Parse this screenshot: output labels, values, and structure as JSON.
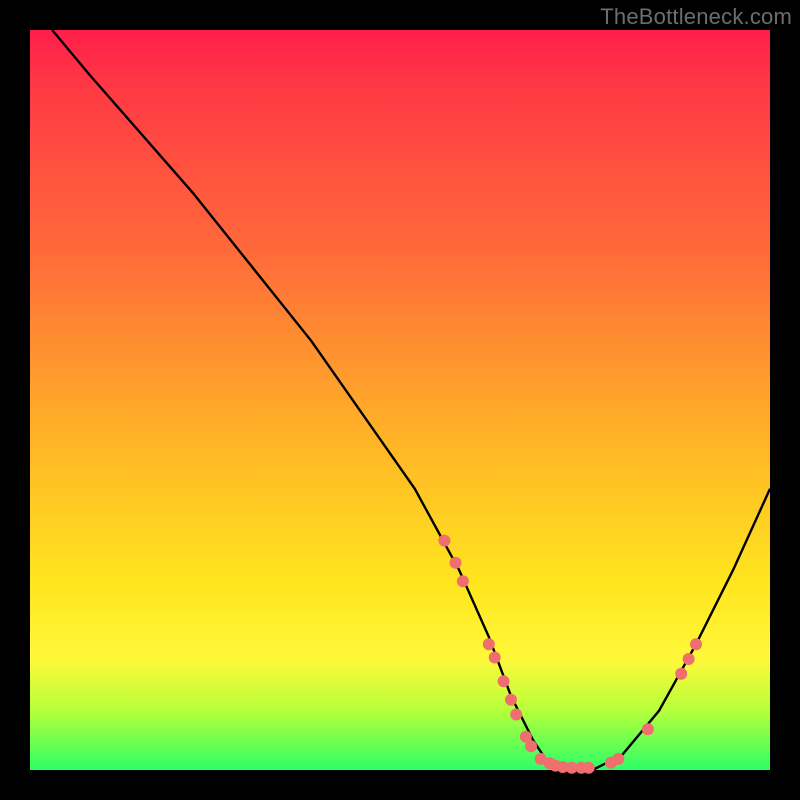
{
  "watermark": "TheBottleneck.com",
  "chart_data": {
    "type": "line",
    "title": "",
    "xlabel": "",
    "ylabel": "",
    "xlim": [
      0,
      100
    ],
    "ylim": [
      0,
      100
    ],
    "background_gradient": {
      "top": "#ff1e4a",
      "upper_mid": "#ff6a3a",
      "mid": "#ffe61e",
      "bottom": "#2bff66"
    },
    "series": [
      {
        "name": "bottleneck-curve",
        "color": "#000000",
        "x": [
          3,
          8,
          15,
          22,
          30,
          38,
          45,
          52,
          58,
          62,
          65,
          68,
          70,
          73,
          76,
          80,
          85,
          90,
          95,
          100
        ],
        "y": [
          100,
          94,
          86,
          78,
          68,
          58,
          48,
          38,
          27,
          18,
          10,
          4,
          1,
          0,
          0,
          2,
          8,
          17,
          27,
          38
        ]
      }
    ],
    "scatter": [
      {
        "name": "marker-dots",
        "color": "#ef6f6f",
        "radius": 6,
        "points": [
          {
            "x": 56,
            "y": 31
          },
          {
            "x": 57.5,
            "y": 28
          },
          {
            "x": 58.5,
            "y": 25.5
          },
          {
            "x": 62,
            "y": 17
          },
          {
            "x": 62.8,
            "y": 15.2
          },
          {
            "x": 64,
            "y": 12
          },
          {
            "x": 65,
            "y": 9.5
          },
          {
            "x": 65.7,
            "y": 7.5
          },
          {
            "x": 67,
            "y": 4.5
          },
          {
            "x": 67.7,
            "y": 3.2
          },
          {
            "x": 69,
            "y": 1.5
          },
          {
            "x": 70.2,
            "y": 0.9
          },
          {
            "x": 71,
            "y": 0.6
          },
          {
            "x": 72,
            "y": 0.4
          },
          {
            "x": 73.2,
            "y": 0.3
          },
          {
            "x": 74.5,
            "y": 0.3
          },
          {
            "x": 75.5,
            "y": 0.3
          },
          {
            "x": 78.5,
            "y": 1.0
          },
          {
            "x": 79.5,
            "y": 1.5
          },
          {
            "x": 83.5,
            "y": 5.5
          },
          {
            "x": 88,
            "y": 13
          },
          {
            "x": 89,
            "y": 15
          },
          {
            "x": 90,
            "y": 17
          }
        ]
      }
    ]
  }
}
